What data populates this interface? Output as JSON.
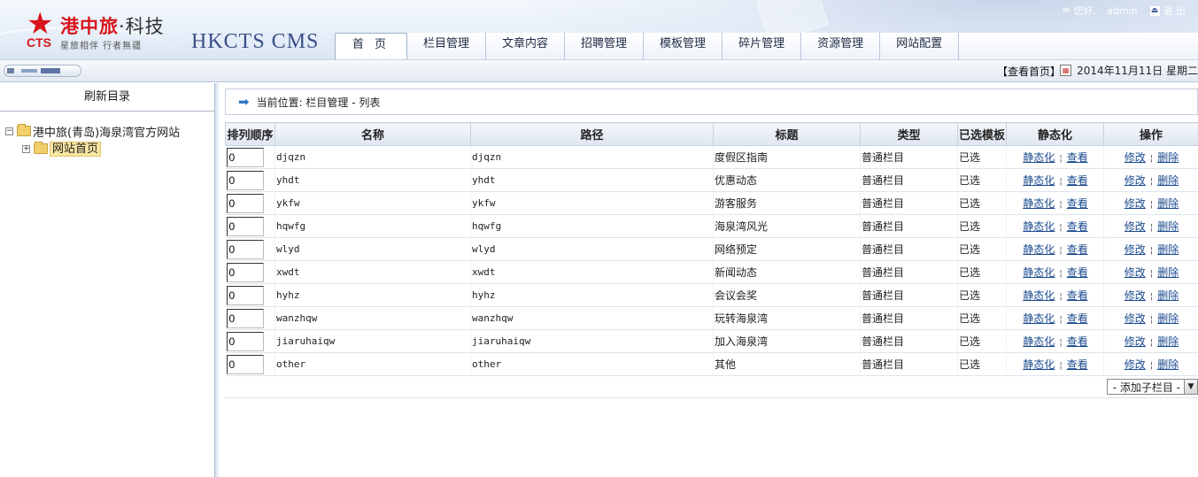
{
  "header": {
    "logo_cn_main": "港中旅",
    "logo_cn_sub": "·科技",
    "logo_cts": "CTS",
    "logo_slogan": "星旅相伴 行者無疆",
    "brand": "HKCTS CMS",
    "greeting": "您好,",
    "username": "admin",
    "logout": "退 出"
  },
  "nav": {
    "tabs": [
      {
        "label": "首 页",
        "active": true
      },
      {
        "label": "栏目管理"
      },
      {
        "label": "文章内容"
      },
      {
        "label": "招聘管理"
      },
      {
        "label": "模板管理"
      },
      {
        "label": "碎片管理"
      },
      {
        "label": "资源管理"
      },
      {
        "label": "网站配置"
      }
    ]
  },
  "toolbar": {
    "view_home": "【查看首页】",
    "date": "2014年11月11日 星期二"
  },
  "sidebar": {
    "refresh": "刷新目录",
    "tree": {
      "root": "港中旅(青岛)海泉湾官方网站",
      "child": "网站首页"
    }
  },
  "location": {
    "text": "当前位置: 栏目管理 - 列表"
  },
  "table": {
    "headers": [
      "排列顺序",
      "名称",
      "路径",
      "标题",
      "类型",
      "已选模板",
      "静态化",
      "操作"
    ],
    "rows": [
      {
        "order": "0",
        "name": "djqzn",
        "path": "djqzn",
        "title": "度假区指南",
        "type": "普通栏目",
        "template": "已选"
      },
      {
        "order": "0",
        "name": "yhdt",
        "path": "yhdt",
        "title": "优惠动态",
        "type": "普通栏目",
        "template": "已选"
      },
      {
        "order": "0",
        "name": "ykfw",
        "path": "ykfw",
        "title": "游客服务",
        "type": "普通栏目",
        "template": "已选"
      },
      {
        "order": "0",
        "name": "hqwfg",
        "path": "hqwfg",
        "title": "海泉湾风光",
        "type": "普通栏目",
        "template": "已选"
      },
      {
        "order": "0",
        "name": "wlyd",
        "path": "wlyd",
        "title": "网络预定",
        "type": "普通栏目",
        "template": "已选"
      },
      {
        "order": "0",
        "name": "xwdt",
        "path": "xwdt",
        "title": "新闻动态",
        "type": "普通栏目",
        "template": "已选"
      },
      {
        "order": "0",
        "name": "hyhz",
        "path": "hyhz",
        "title": "会议会奖",
        "type": "普通栏目",
        "template": "已选"
      },
      {
        "order": "0",
        "name": "wanzhqw",
        "path": "wanzhqw",
        "title": "玩转海泉湾",
        "type": "普通栏目",
        "template": "已选"
      },
      {
        "order": "0",
        "name": "jiaruhaiqw",
        "path": "jiaruhaiqw",
        "title": "加入海泉湾",
        "type": "普通栏目",
        "template": "已选"
      },
      {
        "order": "0",
        "name": "other",
        "path": "other",
        "title": "其他",
        "type": "普通栏目",
        "template": "已选"
      }
    ],
    "actions": {
      "static": "静态化",
      "view": "查看",
      "edit": "修改",
      "delete": "删除"
    }
  },
  "add_child": {
    "label": "- 添加子栏目 -"
  }
}
